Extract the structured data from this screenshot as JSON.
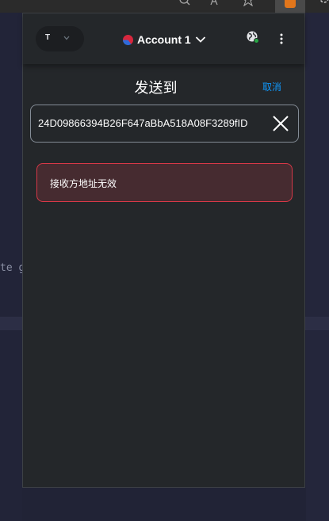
{
  "browser_toolbar": {
    "icons": [
      "zoom-icon",
      "read-aloud-icon",
      "favorite-star-icon",
      "extension-fox-icon",
      "settings-icon"
    ]
  },
  "background_page": {
    "code_snippet": "te ga"
  },
  "popup": {
    "network": {
      "initial": "T"
    },
    "account": {
      "name": "Account 1"
    },
    "title": "发送到",
    "cancel_label": "取消",
    "recipient": {
      "value": "24D09866394B26F647aBbA518A08F3289fID"
    },
    "error_message": "接收方地址无效"
  },
  "colors": {
    "popup_background": "#24272a",
    "accent": "#1098fc",
    "error_border": "#d73847",
    "error_background": "#462b30"
  }
}
